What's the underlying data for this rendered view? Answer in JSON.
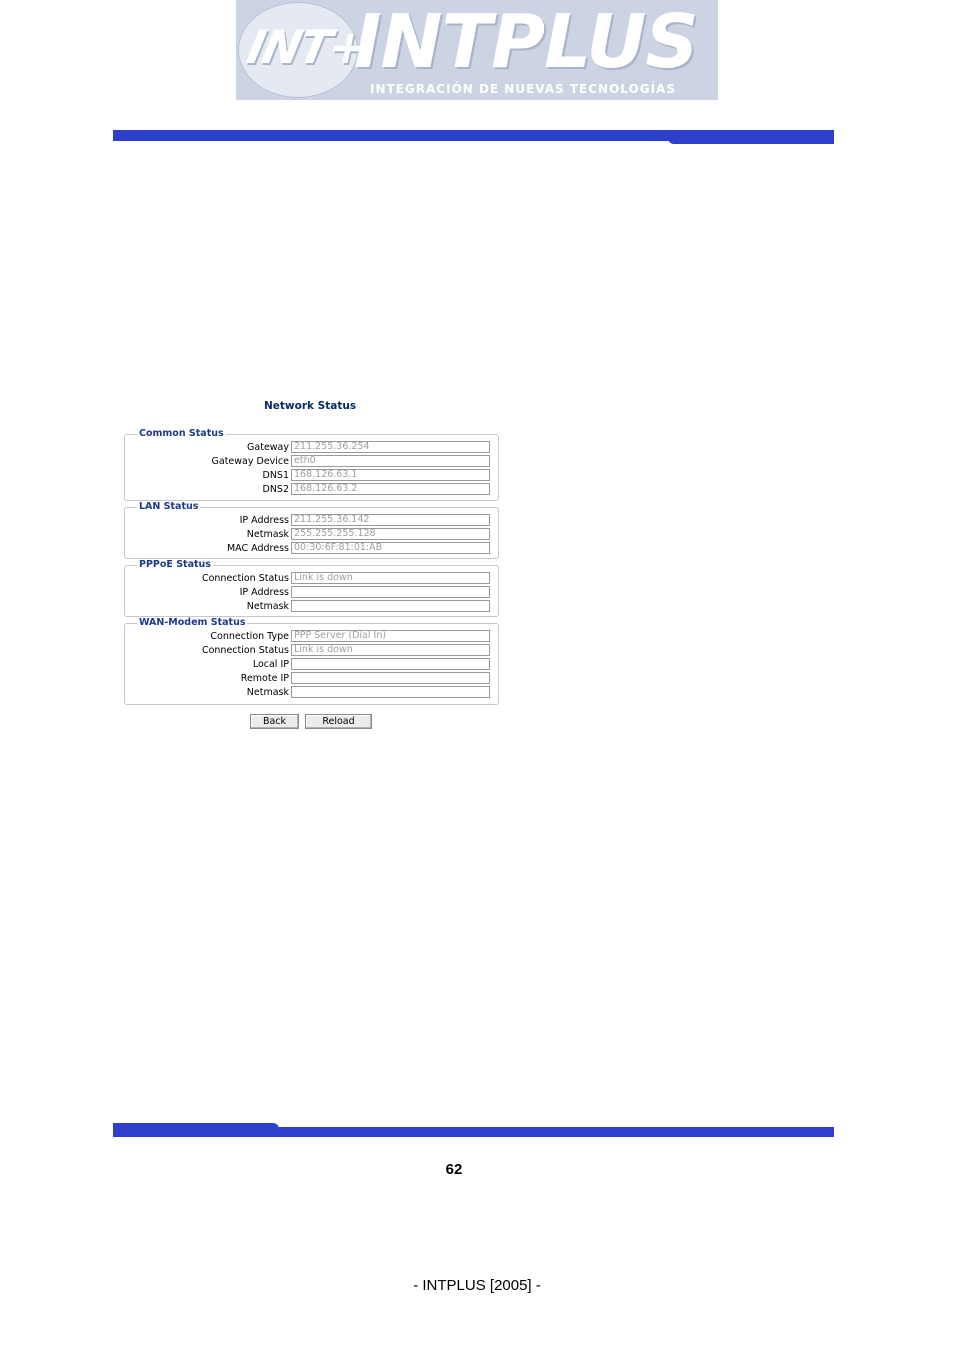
{
  "logo": {
    "mark": "INT+",
    "wordmark": "INTPLUS",
    "tagline": "INTEGRACIÓN  DE  NUEVAS  TECNOLOGÍAS"
  },
  "network_status": {
    "title": "Network Status",
    "common": {
      "legend": "Common Status",
      "rows": [
        {
          "label": "Gateway",
          "value": "211.255.36.254"
        },
        {
          "label": "Gateway Device",
          "value": "eth0"
        },
        {
          "label": "DNS1",
          "value": "168.126.63.1"
        },
        {
          "label": "DNS2",
          "value": "168.126.63.2"
        }
      ]
    },
    "lan": {
      "legend": "LAN Status",
      "rows": [
        {
          "label": "IP Address",
          "value": "211.255.36.142"
        },
        {
          "label": "Netmask",
          "value": "255.255.255.128"
        },
        {
          "label": "MAC Address",
          "value": "00:30:6F:81:01:AB"
        }
      ]
    },
    "pppoe": {
      "legend": "PPPoE Status",
      "rows": [
        {
          "label": "Connection Status",
          "value": "Link is down"
        },
        {
          "label": "IP Address",
          "value": ""
        },
        {
          "label": "Netmask",
          "value": ""
        }
      ]
    },
    "wan": {
      "legend": "WAN-Modem Status",
      "rows": [
        {
          "label": "Connection Type",
          "value": "PPP Server (Dial In)"
        },
        {
          "label": "Connection Status",
          "value": "Link is down"
        },
        {
          "label": "Local IP",
          "value": ""
        },
        {
          "label": "Remote IP",
          "value": ""
        },
        {
          "label": "Netmask",
          "value": ""
        }
      ]
    },
    "buttons": {
      "back": "Back",
      "reload": "Reload"
    }
  },
  "page_number": "62",
  "footer": "- INTPLUS [2005] -",
  "colors": {
    "bar": "#2e3fcc",
    "legend": "#1a3a8c",
    "title": "#0a2a66"
  }
}
